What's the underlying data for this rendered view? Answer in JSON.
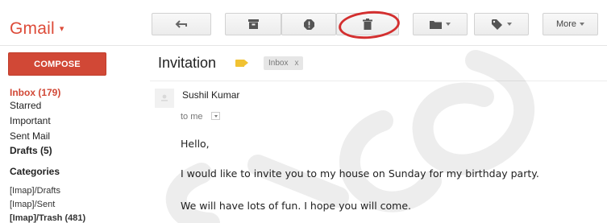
{
  "app": {
    "logo": "Gmail",
    "logo_caret": "▾"
  },
  "toolbar": {
    "back_icon": "reply-arrow-icon",
    "archive_icon": "archive-icon",
    "spam_icon": "report-spam-icon",
    "delete_icon": "trash-icon",
    "move_icon": "folder-icon",
    "labels_icon": "label-tag-icon",
    "more_label": "More"
  },
  "highlight": {
    "target": "delete-button",
    "color": "#d32f2f"
  },
  "sidebar": {
    "compose_label": "COMPOSE",
    "items": [
      {
        "label": "Inbox (179)"
      },
      {
        "label": "Starred"
      },
      {
        "label": "Important"
      },
      {
        "label": "Sent Mail"
      },
      {
        "label": "Drafts (5)"
      }
    ],
    "categories_heading": "Categories",
    "imap_items": [
      {
        "label": "[Imap]/Drafts"
      },
      {
        "label": "[Imap]/Sent"
      },
      {
        "label": "[Imap]/Trash (481)"
      }
    ]
  },
  "message": {
    "subject": "Invitation",
    "label_chip": "Inbox",
    "label_chip_close": "x",
    "sender": "Sushil Kumar",
    "to": "to me",
    "body": [
      "Hello,",
      "I would like to invite you to my house on Sunday for my birthday party.",
      "We will have lots of fun. I hope you will come."
    ]
  },
  "colors": {
    "brand": "#dd4b39",
    "compose": "#d14836",
    "label_tag": "#f1c232"
  }
}
